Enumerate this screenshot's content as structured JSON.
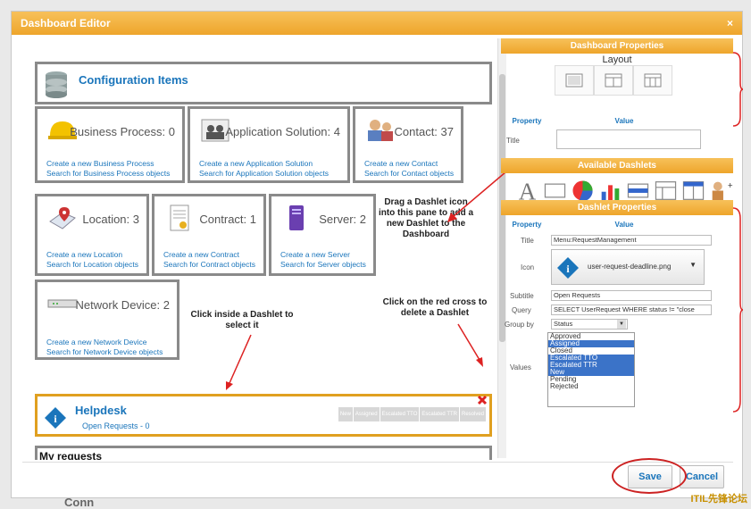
{
  "window": {
    "title": "Dashboard Editor",
    "close_glyph": "×"
  },
  "config": {
    "title": "Configuration Items",
    "cards": [
      {
        "name": "Business Process: 0",
        "create": "Create a new Business Process",
        "search": "Search for Business Process objects",
        "icon": "helmet-icon"
      },
      {
        "name": "Application Solution: 4",
        "create": "Create a new Application Solution",
        "search": "Search for Application Solution objects",
        "icon": "people-group-icon"
      },
      {
        "name": "Contact: 37",
        "create": "Create a new Contact",
        "search": "Search for Contact objects",
        "icon": "contact-icon"
      },
      {
        "name": "Location: 3",
        "create": "Create a new Location",
        "search": "Search for Location objects",
        "icon": "location-icon"
      },
      {
        "name": "Contract: 1",
        "create": "Create a new Contract",
        "search": "Search for Contract objects",
        "icon": "contract-icon"
      },
      {
        "name": "Server: 2",
        "create": "Create a new Server",
        "search": "Search for Server objects",
        "icon": "server-icon"
      },
      {
        "name": "Network Device: 2",
        "create": "Create a new Network Device",
        "search": "Search for Network Device objects",
        "icon": "network-device-icon"
      }
    ]
  },
  "notes": {
    "drag": "Drag a Dashlet icon into this pane to add a new Dashlet to the Dashboard",
    "click_inside": "Click inside a Dashlet to select it",
    "click_cross": "Click on the red cross to delete a Dashlet"
  },
  "helpdesk": {
    "title": "Helpdesk",
    "link": "Open Requests - 0",
    "columns": [
      "New",
      "Assigned",
      "Escalated TTO",
      "Escalated TTR",
      "Resolved"
    ]
  },
  "myrequests": {
    "title": "My requests"
  },
  "right": {
    "dashboard_props": "Dashboard Properties",
    "layout_label": "Layout",
    "property_col": "Property",
    "value_col": "Value",
    "title_label": "Title",
    "available_dashlets": "Available Dashlets",
    "dashlet_props": "Dashlet Properties",
    "fields": {
      "title": {
        "label": "Title",
        "value": "Menu:RequestManagement"
      },
      "icon": {
        "label": "Icon",
        "value": "user-request-deadline.png"
      },
      "subtitle": {
        "label": "Subtitle",
        "value": "Open Requests"
      },
      "query": {
        "label": "Query",
        "value": "SELECT UserRequest WHERE status != \"close"
      },
      "group_by": {
        "label": "Group by",
        "value": "Status"
      },
      "values": {
        "label": "Values"
      }
    },
    "values_list": [
      {
        "label": "Approved",
        "selected": false
      },
      {
        "label": "Assigned",
        "selected": true
      },
      {
        "label": "Closed",
        "selected": false
      },
      {
        "label": "Escalated TTO",
        "selected": true
      },
      {
        "label": "Escalated TTR",
        "selected": true
      },
      {
        "label": "New",
        "selected": true
      },
      {
        "label": "Pending",
        "selected": false
      },
      {
        "label": "Rejected",
        "selected": false
      }
    ]
  },
  "footer": {
    "save": "Save",
    "cancel": "Cancel"
  },
  "watermark": "ITIL先锋论坛",
  "bottom_fragment": "Conn"
}
